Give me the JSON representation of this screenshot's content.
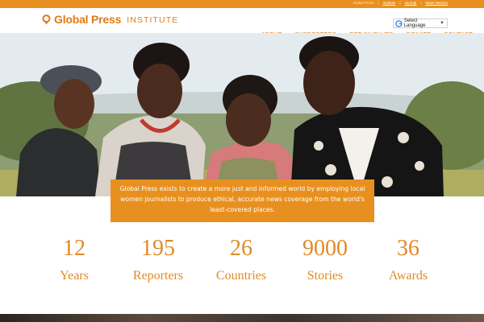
{
  "top_links": [
    "Global Press",
    "Institute",
    "Journal",
    "News Service"
  ],
  "logo": {
    "part1": "Global Press",
    "part2": "INSTITUTE"
  },
  "translate": {
    "label": "Select Language",
    "caret": "▼"
  },
  "nav": [
    "ABOUT",
    "SUPPORTERS",
    "GET INVOLVED",
    "DONATE",
    "CONTACT"
  ],
  "mission": "Global Press exists to create a more just and informed world by employing local women journalists to produce ethical, accurate news coverage from the world's least-covered places.",
  "stats": [
    {
      "number": "12",
      "label": "Years"
    },
    {
      "number": "195",
      "label": "Reporters"
    },
    {
      "number": "26",
      "label": "Countries"
    },
    {
      "number": "9000",
      "label": "Stories"
    },
    {
      "number": "36",
      "label": "Awards"
    }
  ],
  "colors": {
    "brand_orange": "#e8901f",
    "text_orange": "#e08a26"
  },
  "icons": {
    "logo": "location-pin-icon",
    "translate": "google-g-icon"
  }
}
